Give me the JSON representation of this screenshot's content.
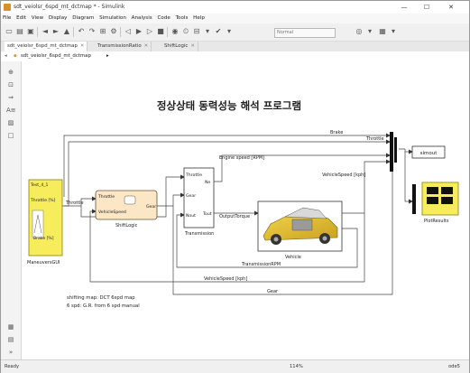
{
  "window": {
    "title": "sdt_veiolsr_6spd_mt_dctmap * - Simulink",
    "minimize": "—",
    "maximize": "☐",
    "close": "✕"
  },
  "menu": [
    "File",
    "Edit",
    "View",
    "Display",
    "Diagram",
    "Simulation",
    "Analysis",
    "Code",
    "Tools",
    "Help"
  ],
  "toolbar": {
    "sim_mode": "Normal"
  },
  "tabs": [
    {
      "label": "sdt_veiolsr_6spd_mt_dctmap"
    },
    {
      "label": "TransmissionRatio"
    },
    {
      "label": "ShiftLogic"
    }
  ],
  "breadcrumb": "sdt_veiolsr_6spd_mt_dctmap",
  "diagram": {
    "title": "정상상태 동력성능 해석 프로그램",
    "blocks": {
      "maneuvers": {
        "signal_name": "Test_4_1",
        "out1": "Throttle [%]",
        "out2": "Brake [%]",
        "name": "ManeuversGUI"
      },
      "shiftlogic": {
        "in1": "Throttle",
        "in2": "VehicleSpeed",
        "out": "Gear",
        "name": "ShiftLogic"
      },
      "transmission": {
        "in1": "Throttle",
        "in2": "Gear",
        "in3": "Nout",
        "out1": "Ne",
        "out2": "Tout",
        "name": "Transmission"
      },
      "vehicle": {
        "name": "Vehicle"
      },
      "simout": {
        "label": "simout"
      },
      "plot": {
        "name": "PlotResults"
      }
    },
    "signals": {
      "brake": "Brake",
      "throttle_top": "Throttle",
      "throttle_left": "Throttle",
      "engine_speed": "Engine speed [RPM]",
      "vehicle_speed_right": "VehicleSpeed [kph]",
      "output_torque": "OutputTorque",
      "transmission_rpm": "TransmissionRPM",
      "vehicle_speed_bottom": "VehicleSpeed [kph]",
      "gear": "Gear"
    },
    "notes": [
      "shifting map: DCT 6spd map",
      "6 spd: G.R. from 6 spd manual"
    ]
  },
  "status": {
    "left": "Ready",
    "center": "114%",
    "right": "ode5"
  }
}
